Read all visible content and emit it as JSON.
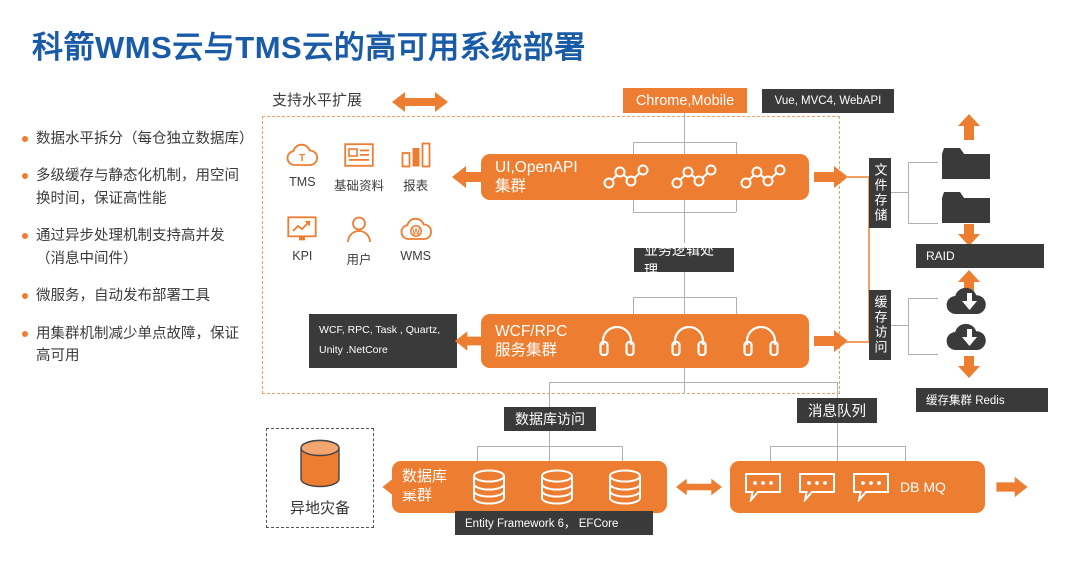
{
  "title": "科箭WMS云与TMS云的高可用系统部署",
  "bullets": [
    "数据水平拆分（每仓独立数据库）",
    "多级缓存与静态化机制，用空间换时间，保证高性能",
    "通过异步处理机制支持高并发（消息中间件）",
    "微服务，自动发布部署工具",
    "用集群机制减少单点故障，保证高可用"
  ],
  "scale_note": "支持水平扩展",
  "client_box": "Chrome,Mobile",
  "tech_web": "Vue, MVC4, WebAPI",
  "tech_service": "WCF, RPC, Task , Quartz, Unity .NetCore",
  "tech_db": "Entity Framework 6，  EFCore",
  "app_icons": [
    {
      "name": "TMS",
      "icon": "cloud-t-icon"
    },
    {
      "name": "基础资料",
      "icon": "id-card-icon"
    },
    {
      "name": "报表",
      "icon": "bar-chart-icon"
    },
    {
      "name": "KPI",
      "icon": "monitor-chart-icon"
    },
    {
      "name": "用户",
      "icon": "user-icon"
    },
    {
      "name": "WMS",
      "icon": "cloud-w-icon"
    }
  ],
  "clusters": {
    "ui": {
      "label": "UI,OpenAPI\n集群",
      "icon": "network-nodes-icon",
      "count": 3
    },
    "service": {
      "label": "WCF/RPC\n服务集群",
      "icon": "headphones-icon",
      "count": 3
    },
    "database": {
      "label": "数据库\n集群",
      "icon": "database-cylinder-icon",
      "count": 3
    },
    "mq": {
      "label": "",
      "icon": "chat-bubble-icon",
      "count": 3,
      "trailing_label": "DB MQ"
    }
  },
  "layer_labels": {
    "business_logic": "业务逻辑处理",
    "db_access": "数据库访问",
    "message_queue": "消息队列",
    "file_storage": "文件存储",
    "cache_access": "缓存访问"
  },
  "storage": {
    "raid": "RAID",
    "cache_cluster": "缓存集群   Redis",
    "folder_icon": "folder-icon",
    "cloud_download_icon": "cloud-download-icon"
  },
  "disaster_recovery": {
    "label": "异地灾备",
    "icon": "database-cylinder-icon"
  },
  "colors": {
    "title_blue": "#1a5ba8",
    "orange": "#ED7D31",
    "dark": "#3a3a3a",
    "dashed_border": "#F0A060",
    "line_gray": "#b0b0b0"
  }
}
